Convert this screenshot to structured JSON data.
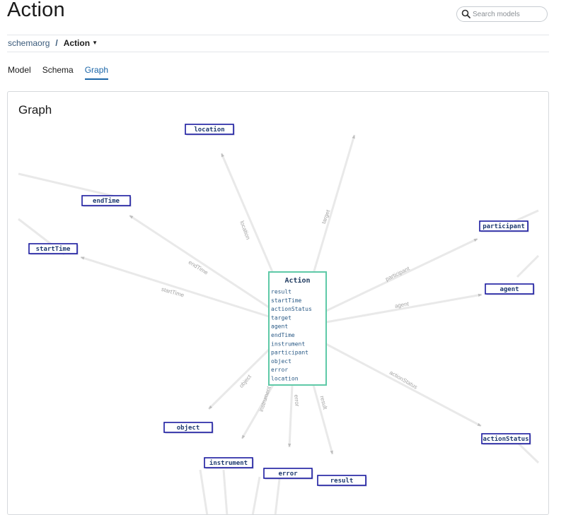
{
  "page": {
    "title": "Action"
  },
  "search": {
    "placeholder": "Search models"
  },
  "breadcrumb": {
    "root": "schemaorg",
    "separator": "/",
    "current": "Action"
  },
  "tabs": [
    {
      "label": "Model",
      "active": false
    },
    {
      "label": "Schema",
      "active": false
    },
    {
      "label": "Graph",
      "active": true
    }
  ],
  "graph": {
    "title": "Graph",
    "center": {
      "title": "Action",
      "fields": [
        "result",
        "startTime",
        "actionStatus",
        "target",
        "agent",
        "endTime",
        "instrument",
        "participant",
        "object",
        "error",
        "location"
      ]
    },
    "nodes": [
      {
        "id": "location",
        "label": "location",
        "edge_label": "location"
      },
      {
        "id": "target",
        "label": "",
        "edge_label": "target"
      },
      {
        "id": "endTime",
        "label": "endTime",
        "edge_label": "endTime"
      },
      {
        "id": "startTime",
        "label": "startTime",
        "edge_label": "startTime"
      },
      {
        "id": "participant",
        "label": "participant",
        "edge_label": "participant"
      },
      {
        "id": "agent",
        "label": "agent",
        "edge_label": "agent"
      },
      {
        "id": "actionStatus",
        "label": "actionStatus",
        "edge_label": "actionStatus"
      },
      {
        "id": "object",
        "label": "object",
        "edge_label": "object"
      },
      {
        "id": "instrument",
        "label": "instrument",
        "edge_label": "instrument"
      },
      {
        "id": "error",
        "label": "error",
        "edge_label": "error"
      },
      {
        "id": "result",
        "label": "result",
        "edge_label": "result"
      }
    ],
    "colors": {
      "center_border": "#5ec9a7",
      "center_title": "#1f3a5f",
      "field_text": "#2a5a86",
      "node_border": "#1a1aa0",
      "node_text": "#1f3a6f",
      "edge": "#e9e9e9",
      "edge_label": "#a3a3a3",
      "arrow": "#bdbdbd"
    }
  }
}
